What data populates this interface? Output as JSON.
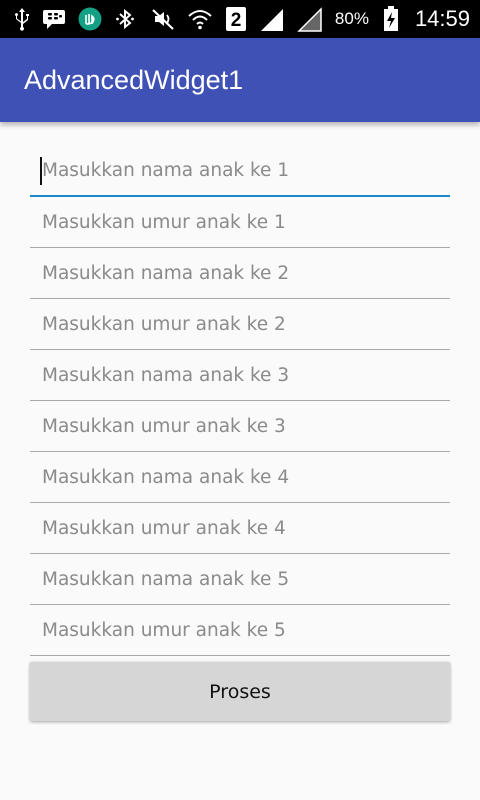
{
  "status_bar": {
    "icons": [
      "usb-icon",
      "bbm-icon",
      "allah-icon",
      "bluetooth-icon",
      "mute-icon",
      "wifi-icon",
      "sim-2-icon",
      "signal-icon",
      "signal-empty-icon",
      "battery-charging-icon"
    ],
    "sim_label": "2",
    "battery": "80%",
    "time": "14:59"
  },
  "app_bar": {
    "title": "AdvancedWidget1",
    "color": "#3f51b5"
  },
  "form": {
    "fields": [
      {
        "placeholder": "Masukkan nama anak ke 1",
        "value": "",
        "focused": true
      },
      {
        "placeholder": "Masukkan umur anak ke 1",
        "value": ""
      },
      {
        "placeholder": "Masukkan nama anak ke 2",
        "value": ""
      },
      {
        "placeholder": "Masukkan umur anak ke 2",
        "value": ""
      },
      {
        "placeholder": "Masukkan nama anak ke 3",
        "value": ""
      },
      {
        "placeholder": "Masukkan umur anak ke 3",
        "value": ""
      },
      {
        "placeholder": "Masukkan nama anak ke 4",
        "value": ""
      },
      {
        "placeholder": "Masukkan umur anak ke 4",
        "value": ""
      },
      {
        "placeholder": "Masukkan nama anak ke 5",
        "value": ""
      },
      {
        "placeholder": "Masukkan umur anak ke 5",
        "value": ""
      }
    ],
    "focus_color": "#1e88c8",
    "submit_label": "Proses"
  }
}
